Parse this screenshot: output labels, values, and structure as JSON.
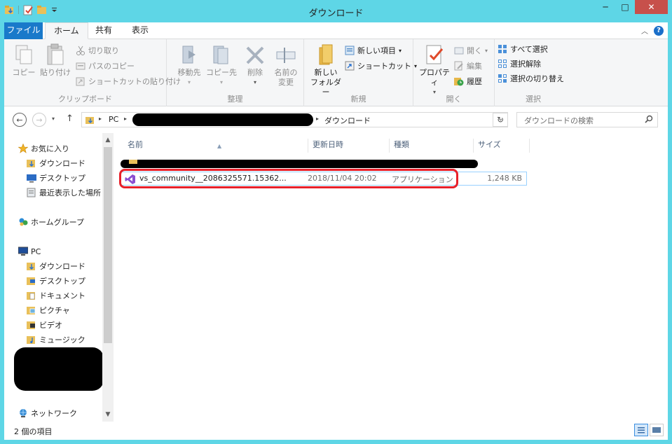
{
  "window": {
    "title": "ダウンロード",
    "controls": {
      "minimize": "─",
      "maximize": "□",
      "close": "✕"
    }
  },
  "ribbon_tabs": [
    {
      "label": "ファイル"
    },
    {
      "label": "ホーム"
    },
    {
      "label": "共有"
    },
    {
      "label": "表示"
    }
  ],
  "ribbon": {
    "clipboard": {
      "label": "クリップボード",
      "copy": "コピー",
      "paste": "貼り付け",
      "cut": "切り取り",
      "copy_path": "パスのコピー",
      "paste_shortcut": "ショートカットの貼り付け"
    },
    "organize": {
      "label": "整理",
      "move_to": "移動先",
      "copy_to": "コピー先",
      "delete": "削除",
      "rename_l1": "名前の",
      "rename_l2": "変更"
    },
    "new": {
      "label": "新規",
      "new_folder_l1": "新しい",
      "new_folder_l2": "フォルダー",
      "new_item": "新しい項目",
      "shortcut": "ショートカット"
    },
    "open": {
      "label": "開く",
      "properties": "プロパティ",
      "open": "開く",
      "edit": "編集",
      "history": "履歴"
    },
    "select": {
      "label": "選択",
      "select_all": "すべて選択",
      "select_none": "選択解除",
      "invert": "選択の切り替え"
    }
  },
  "address": {
    "root": "PC",
    "current": "ダウンロード",
    "search_placeholder": "ダウンロードの検索"
  },
  "nav": {
    "favorites": "お気に入り",
    "fav_downloads": "ダウンロード",
    "fav_desktop": "デスクトップ",
    "fav_recent": "最近表示した場所",
    "homegroup": "ホームグループ",
    "pc": "PC",
    "pc_downloads": "ダウンロード",
    "pc_desktop": "デスクトップ",
    "pc_documents": "ドキュメント",
    "pc_pictures": "ピクチャ",
    "pc_videos": "ビデオ",
    "pc_music": "ミュージック",
    "network": "ネットワーク"
  },
  "columns": {
    "name": "名前",
    "date": "更新日時",
    "type": "種類",
    "size": "サイズ"
  },
  "files": [
    {
      "name": "vs_community__2086325571.15362...",
      "date": "2018/11/04 20:02",
      "type": "アプリケーション",
      "size": "1,248 KB"
    }
  ],
  "status": {
    "item_count": "2 個の項目"
  },
  "colors": {
    "title_bar": "#5ed6e6",
    "file_tab": "#1979ca",
    "highlight": "#e8202a",
    "vs_icon": "#8a4fd1"
  }
}
